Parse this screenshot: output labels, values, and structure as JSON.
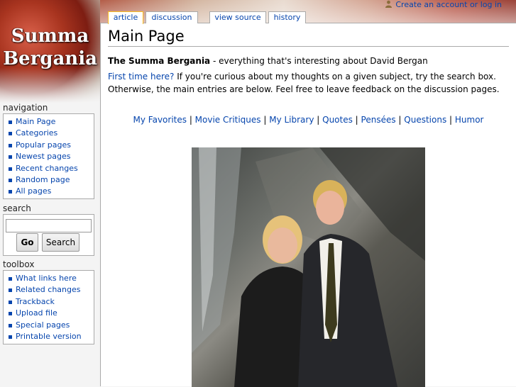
{
  "site": {
    "logo_line1": "Summa",
    "logo_line2": "Bergania"
  },
  "personal_tools": {
    "create_account": "Create an account or log in"
  },
  "tabs": [
    {
      "label": "article",
      "selected": true
    },
    {
      "label": "discussion"
    },
    {
      "label": "view source"
    },
    {
      "label": "history"
    }
  ],
  "page": {
    "title": "Main Page",
    "intro_bold": "The Summa Bergania",
    "intro_rest": " - everything that's interesting about David Bergan",
    "first_time_link": "First time here?",
    "first_time_text": " If you're curious about my thoughts on a given subject, try the search box. Otherwise, the main entries are below. Feel free to leave feedback on the discussion pages.",
    "menu_links": [
      "My Favorites",
      "Movie Critiques",
      "My Library",
      "Quotes",
      "Pensées",
      "Questions",
      "Humor"
    ],
    "menu_separator": " | "
  },
  "navigation": {
    "heading": "navigation",
    "items": [
      "Main Page",
      "Categories",
      "Popular pages",
      "Newest pages",
      "Recent changes",
      "Random page",
      "All pages"
    ]
  },
  "search": {
    "heading": "search",
    "input_value": "",
    "go_label": "Go",
    "search_label": "Search"
  },
  "toolbox": {
    "heading": "toolbox",
    "items": [
      "What links here",
      "Related changes",
      "Trackback",
      "Upload file",
      "Special pages",
      "Printable version"
    ]
  },
  "colors": {
    "link": "#0645ad",
    "tab_selected_border": "#fabd23"
  }
}
